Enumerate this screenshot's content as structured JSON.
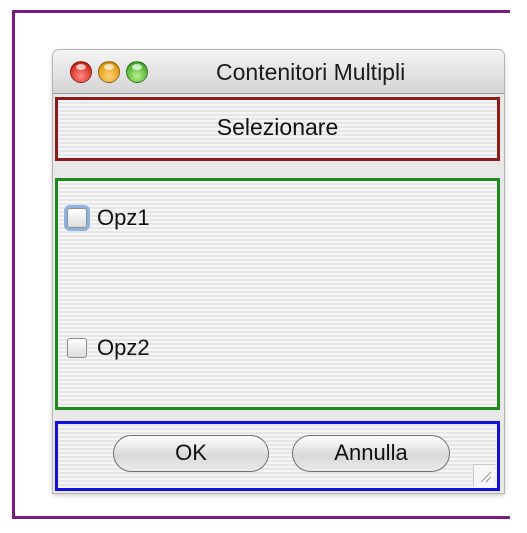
{
  "window": {
    "title": "Contenitori Multipli"
  },
  "header": {
    "label": "Selezionare"
  },
  "options": [
    {
      "label": "Opz1",
      "checked": false,
      "focused": true
    },
    {
      "label": "Opz2",
      "checked": false,
      "focused": false
    }
  ],
  "buttons": {
    "ok_label": "OK",
    "cancel_label": "Annulla"
  },
  "icons": {
    "close": "close-traffic-light-icon",
    "minimize": "minimize-traffic-light-icon",
    "zoom": "zoom-traffic-light-icon",
    "resize": "resize-grip-icon"
  },
  "colors": {
    "outer_frame": "#7a1c84",
    "header_border": "#8b1a1a",
    "options_border": "#1e8a1e",
    "buttons_border": "#1212e0"
  }
}
